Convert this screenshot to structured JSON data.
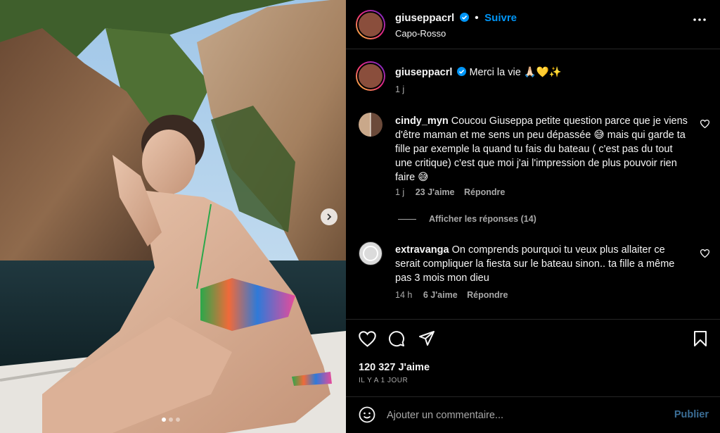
{
  "post": {
    "author": "giuseppacrl",
    "follow_label": "Suivre",
    "location": "Capo-Rosso",
    "caption_text": "Merci la vie 🙏🏻💛✨",
    "caption_time": "1 j",
    "likes": "120 327 J'aime",
    "date": "IL Y A 1 JOUR"
  },
  "comments": [
    {
      "user": "cindy_myn",
      "text": "Coucou Giuseppa petite question parce que je viens d'être maman et me sens un peu dépassée 😅 mais qui garde ta fille par exemple la quand tu fais du bateau ( c'est pas du tout une critique) c'est que moi j'ai l'impression de plus pouvoir rien faire 😅",
      "time": "1 j",
      "likes": "23 J'aime",
      "reply": "Répondre",
      "view_replies": "Afficher les réponses (14)"
    },
    {
      "user": "extravanga",
      "text": "On comprends pourquoi tu veux plus allaiter ce serait compliquer la fiesta sur le bateau sinon.. ta fille a même pas 3 mois mon dieu",
      "time": "14 h",
      "likes": "6 J'aime",
      "reply": "Répondre"
    }
  ],
  "composer": {
    "placeholder": "Ajouter un commentaire...",
    "publish_label": "Publier"
  },
  "carousel": {
    "slide_count": 3,
    "active_index": 0
  },
  "colors": {
    "accent": "#0095f6",
    "background": "#000000",
    "muted": "#a8a8a8",
    "divider": "#262626"
  },
  "icons": [
    "verified-badge-icon",
    "more-options-icon",
    "heart-icon",
    "comment-icon",
    "share-icon",
    "bookmark-icon",
    "emoji-icon",
    "chevron-right-icon"
  ]
}
